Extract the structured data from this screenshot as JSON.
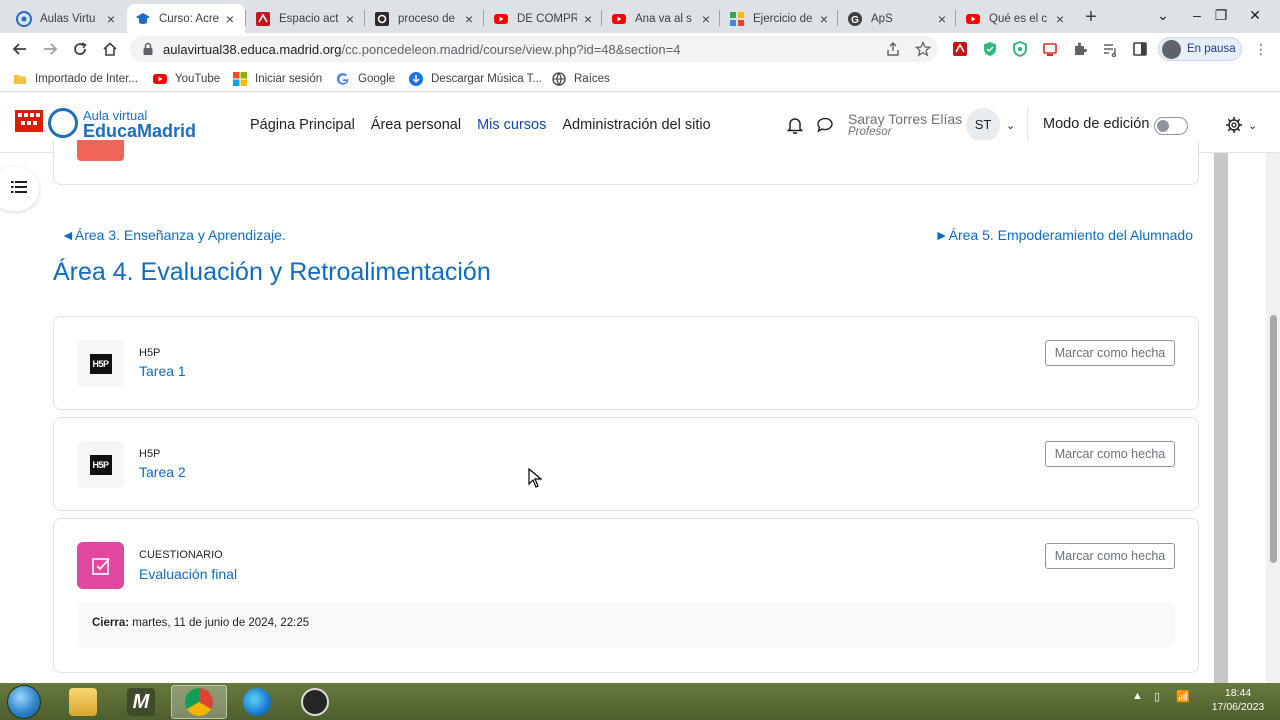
{
  "browser": {
    "tabs": [
      {
        "label": "Aulas Virtu",
        "icon": "moodle-icon"
      },
      {
        "label": "Curso: Acre",
        "icon": "graduation-cap-icon"
      },
      {
        "label": "Espacio act",
        "icon": "pdf-icon"
      },
      {
        "label": "proceso de",
        "icon": "quizlet-icon"
      },
      {
        "label": "DE COMPR",
        "icon": "youtube-icon"
      },
      {
        "label": "Ana va al s",
        "icon": "youtube-icon"
      },
      {
        "label": "Ejercicio de",
        "icon": "app-icon"
      },
      {
        "label": "ApS",
        "icon": "google-icon"
      },
      {
        "label": "Qué es el c",
        "icon": "youtube-icon"
      }
    ],
    "url_host": "aulavirtual38.educa.madrid.org",
    "url_path": "/cc.poncedeleon.madrid/course/view.php?id=48&section=4",
    "profile_status": "En pausa",
    "bookmarks": [
      {
        "label": "Importado de Inter...",
        "icon": "folder-icon"
      },
      {
        "label": "YouTube",
        "icon": "youtube-icon"
      },
      {
        "label": "Iniciar sesión",
        "icon": "microsoft-icon"
      },
      {
        "label": "Google",
        "icon": "google-icon"
      },
      {
        "label": "Descargar Música T...",
        "icon": "download-icon"
      },
      {
        "label": "Raíces",
        "icon": "globe-icon"
      }
    ]
  },
  "site": {
    "logo_top": "Aula virtual",
    "logo_bottom": "EducaMadrid",
    "nav": [
      "Página Principal",
      "Área personal",
      "Mis cursos",
      "Administración del sitio"
    ],
    "active_nav": "Mis cursos",
    "user_name": "Saray Torres Elías",
    "user_role": "Profesor",
    "user_initials": "ST",
    "edit_mode_label": "Modo de edición",
    "edit_mode_on": false
  },
  "section": {
    "prev_link": "◄Área 3. Enseñanza y Aprendizaje.",
    "next_link": "►Área 5. Empoderamiento del Alumnado",
    "title": "Área 4. Evaluación y Retroalimentación",
    "activities": [
      {
        "type": "H5P",
        "name": "Tarea 1",
        "button": "Marcar como hecha"
      },
      {
        "type": "H5P",
        "name": "Tarea 2",
        "button": "Marcar como hecha"
      },
      {
        "type": "CUESTIONARIO",
        "name": "Evaluación final",
        "button": "Marcar como hecha",
        "dates_label": "Cierra:",
        "dates_value": " martes, 11 de junio de 2024, 22:25"
      }
    ],
    "h5p_logo_text": "H5P"
  },
  "taskbar": {
    "time": "18:44",
    "date": "17/06/2023"
  },
  "colors": {
    "link_blue": "#0f6cbf",
    "quiz_pink": "#e2479f",
    "taskbar_green": "#5a6e35"
  }
}
